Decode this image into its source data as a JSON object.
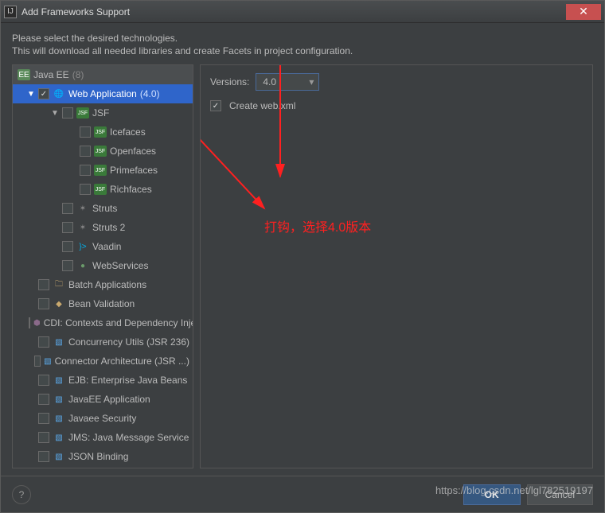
{
  "window": {
    "title": "Add Frameworks Support",
    "close": "✕"
  },
  "description": {
    "line1": "Please select the desired technologies.",
    "line2": "This will download all needed libraries and create Facets in project configuration."
  },
  "tree": {
    "header_label": "Java EE",
    "header_count": "(8)",
    "items": [
      {
        "label": "Web Application",
        "suffix": "(4.0)",
        "checked": true,
        "expanded": true,
        "icon": "web",
        "indent": 1,
        "selected": true,
        "arrow": "▼"
      },
      {
        "label": "JSF",
        "checked": false,
        "expanded": true,
        "icon": "jsf",
        "indent": 2,
        "arrow": "▼"
      },
      {
        "label": "Icefaces",
        "checked": false,
        "icon": "jsf",
        "indent": 3
      },
      {
        "label": "Openfaces",
        "checked": false,
        "icon": "jsf",
        "indent": 3
      },
      {
        "label": "Primefaces",
        "checked": false,
        "icon": "jsf",
        "indent": 3
      },
      {
        "label": "Richfaces",
        "checked": false,
        "icon": "jsf",
        "indent": 3
      },
      {
        "label": "Struts",
        "checked": false,
        "icon": "gear",
        "indent": 2
      },
      {
        "label": "Struts 2",
        "checked": false,
        "icon": "gear",
        "indent": 2
      },
      {
        "label": "Vaadin",
        "checked": false,
        "icon": "vaadin",
        "indent": 2
      },
      {
        "label": "WebServices",
        "checked": false,
        "icon": "ws",
        "indent": 2
      },
      {
        "label": "Batch Applications",
        "checked": false,
        "icon": "folder",
        "indent": 1
      },
      {
        "label": "Bean Validation",
        "checked": false,
        "icon": "shield",
        "indent": 1
      },
      {
        "label": "CDI: Contexts and Dependency Injection",
        "checked": false,
        "icon": "cdi",
        "indent": 1
      },
      {
        "label": "Concurrency Utils (JSR 236)",
        "checked": false,
        "icon": "blue",
        "indent": 1
      },
      {
        "label": "Connector Architecture (JSR ...)",
        "checked": false,
        "icon": "blue",
        "indent": 1
      },
      {
        "label": "EJB: Enterprise Java Beans",
        "checked": false,
        "icon": "blue",
        "indent": 1
      },
      {
        "label": "JavaEE Application",
        "checked": false,
        "icon": "blue",
        "indent": 1
      },
      {
        "label": "Javaee Security",
        "checked": false,
        "icon": "blue",
        "indent": 1
      },
      {
        "label": "JMS: Java Message Service",
        "checked": false,
        "icon": "blue",
        "indent": 1
      },
      {
        "label": "JSON Binding",
        "checked": false,
        "icon": "blue",
        "indent": 1
      }
    ]
  },
  "right": {
    "versions_label": "Versions:",
    "version_selected": "4.0",
    "create_webxml_label": "Create web.xml",
    "create_webxml_checked": true
  },
  "annotation": "打钩，选择4.0版本",
  "buttons": {
    "help": "?",
    "ok": "OK",
    "cancel": "Cancel"
  },
  "watermark": "https://blog.csdn.net/lgl782519197"
}
